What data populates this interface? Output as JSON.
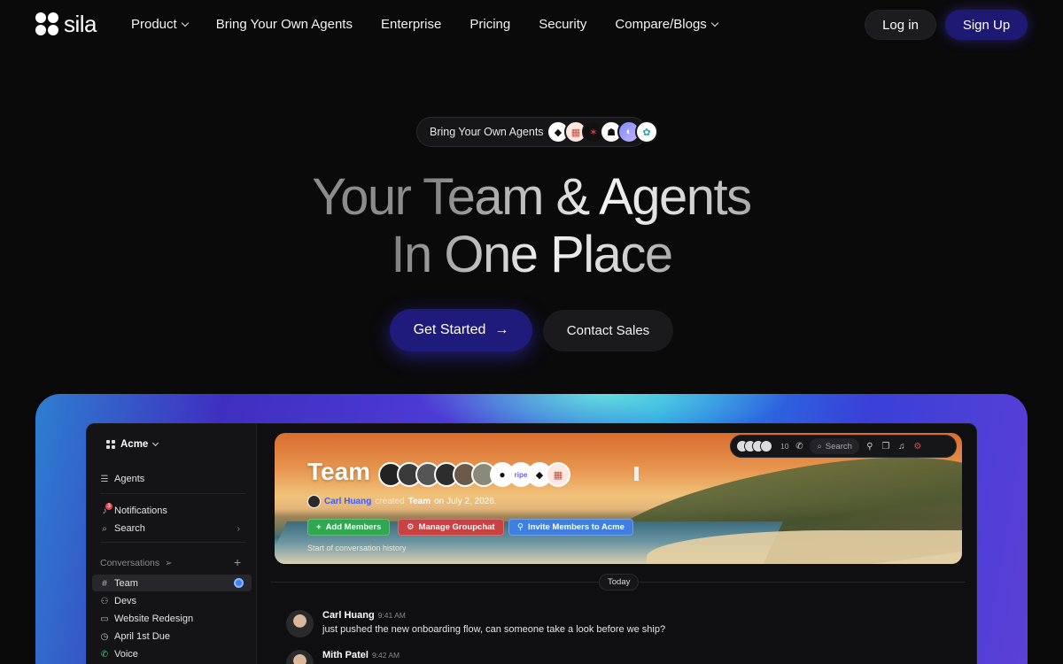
{
  "nav": {
    "brand": "sila",
    "links": [
      {
        "label": "Product",
        "dropdown": true
      },
      {
        "label": "Bring Your Own Agents",
        "dropdown": false
      },
      {
        "label": "Enterprise",
        "dropdown": false
      },
      {
        "label": "Pricing",
        "dropdown": false
      },
      {
        "label": "Security",
        "dropdown": false
      },
      {
        "label": "Compare/Blogs",
        "dropdown": true
      }
    ],
    "login": "Log in",
    "signup": "Sign Up"
  },
  "hero": {
    "pill": "Bring Your Own Agents",
    "pill_icons": [
      "cube-logo-icon",
      "robot-icon",
      "crab-icon",
      "skull-icon",
      "gradient-orb-icon",
      "flower-icon"
    ],
    "headline_line1_a": "Your ",
    "headline_line1_b": "Team & Agents",
    "headline_line2": "In One Place",
    "cta_primary": "Get Started",
    "cta_secondary": "Contact Sales"
  },
  "app": {
    "workspace": "Acme",
    "sidebar": {
      "agents": "Agents",
      "notifications": "Notifications",
      "notifications_badge": "3",
      "search": "Search",
      "section": "Conversations",
      "channels": [
        {
          "label": "Team",
          "icon": "hash-icon",
          "active": true
        },
        {
          "label": "Devs",
          "icon": "users-icon",
          "active": false
        },
        {
          "label": "Website Redesign",
          "icon": "folder-icon",
          "active": false
        },
        {
          "label": "April 1st Due",
          "icon": "clock-icon",
          "active": false
        },
        {
          "label": "Voice",
          "icon": "phone-icon",
          "active": false
        }
      ]
    },
    "banner": {
      "title": "Team",
      "creator": "Carl Huang",
      "created_text": "created",
      "channel": "Team",
      "date_text": "on July 2, 2026.",
      "btn_add": "Add Members",
      "btn_manage": "Manage Groupchat",
      "btn_invite": "Invite Members to Acme",
      "start_text": "Start of conversation history",
      "member_labels": [
        "",
        "",
        "",
        "",
        "",
        "",
        "",
        "ripe",
        "",
        ""
      ]
    },
    "toolbar": {
      "count": "10",
      "search": "Search"
    },
    "day_label": "Today",
    "messages": [
      {
        "name": "Carl Huang",
        "time": "9:41 AM",
        "text": "just pushed the new onboarding flow, can someone take a look before we ship?"
      },
      {
        "name": "Mith Patel",
        "time": "9:42 AM",
        "text": ""
      }
    ]
  },
  "colors": {
    "background": "#0a0a0b",
    "primary_button": "#1f1b7a",
    "accent_green": "#2fa84f",
    "accent_red": "#c74242",
    "accent_blue": "#3f7fe0"
  }
}
